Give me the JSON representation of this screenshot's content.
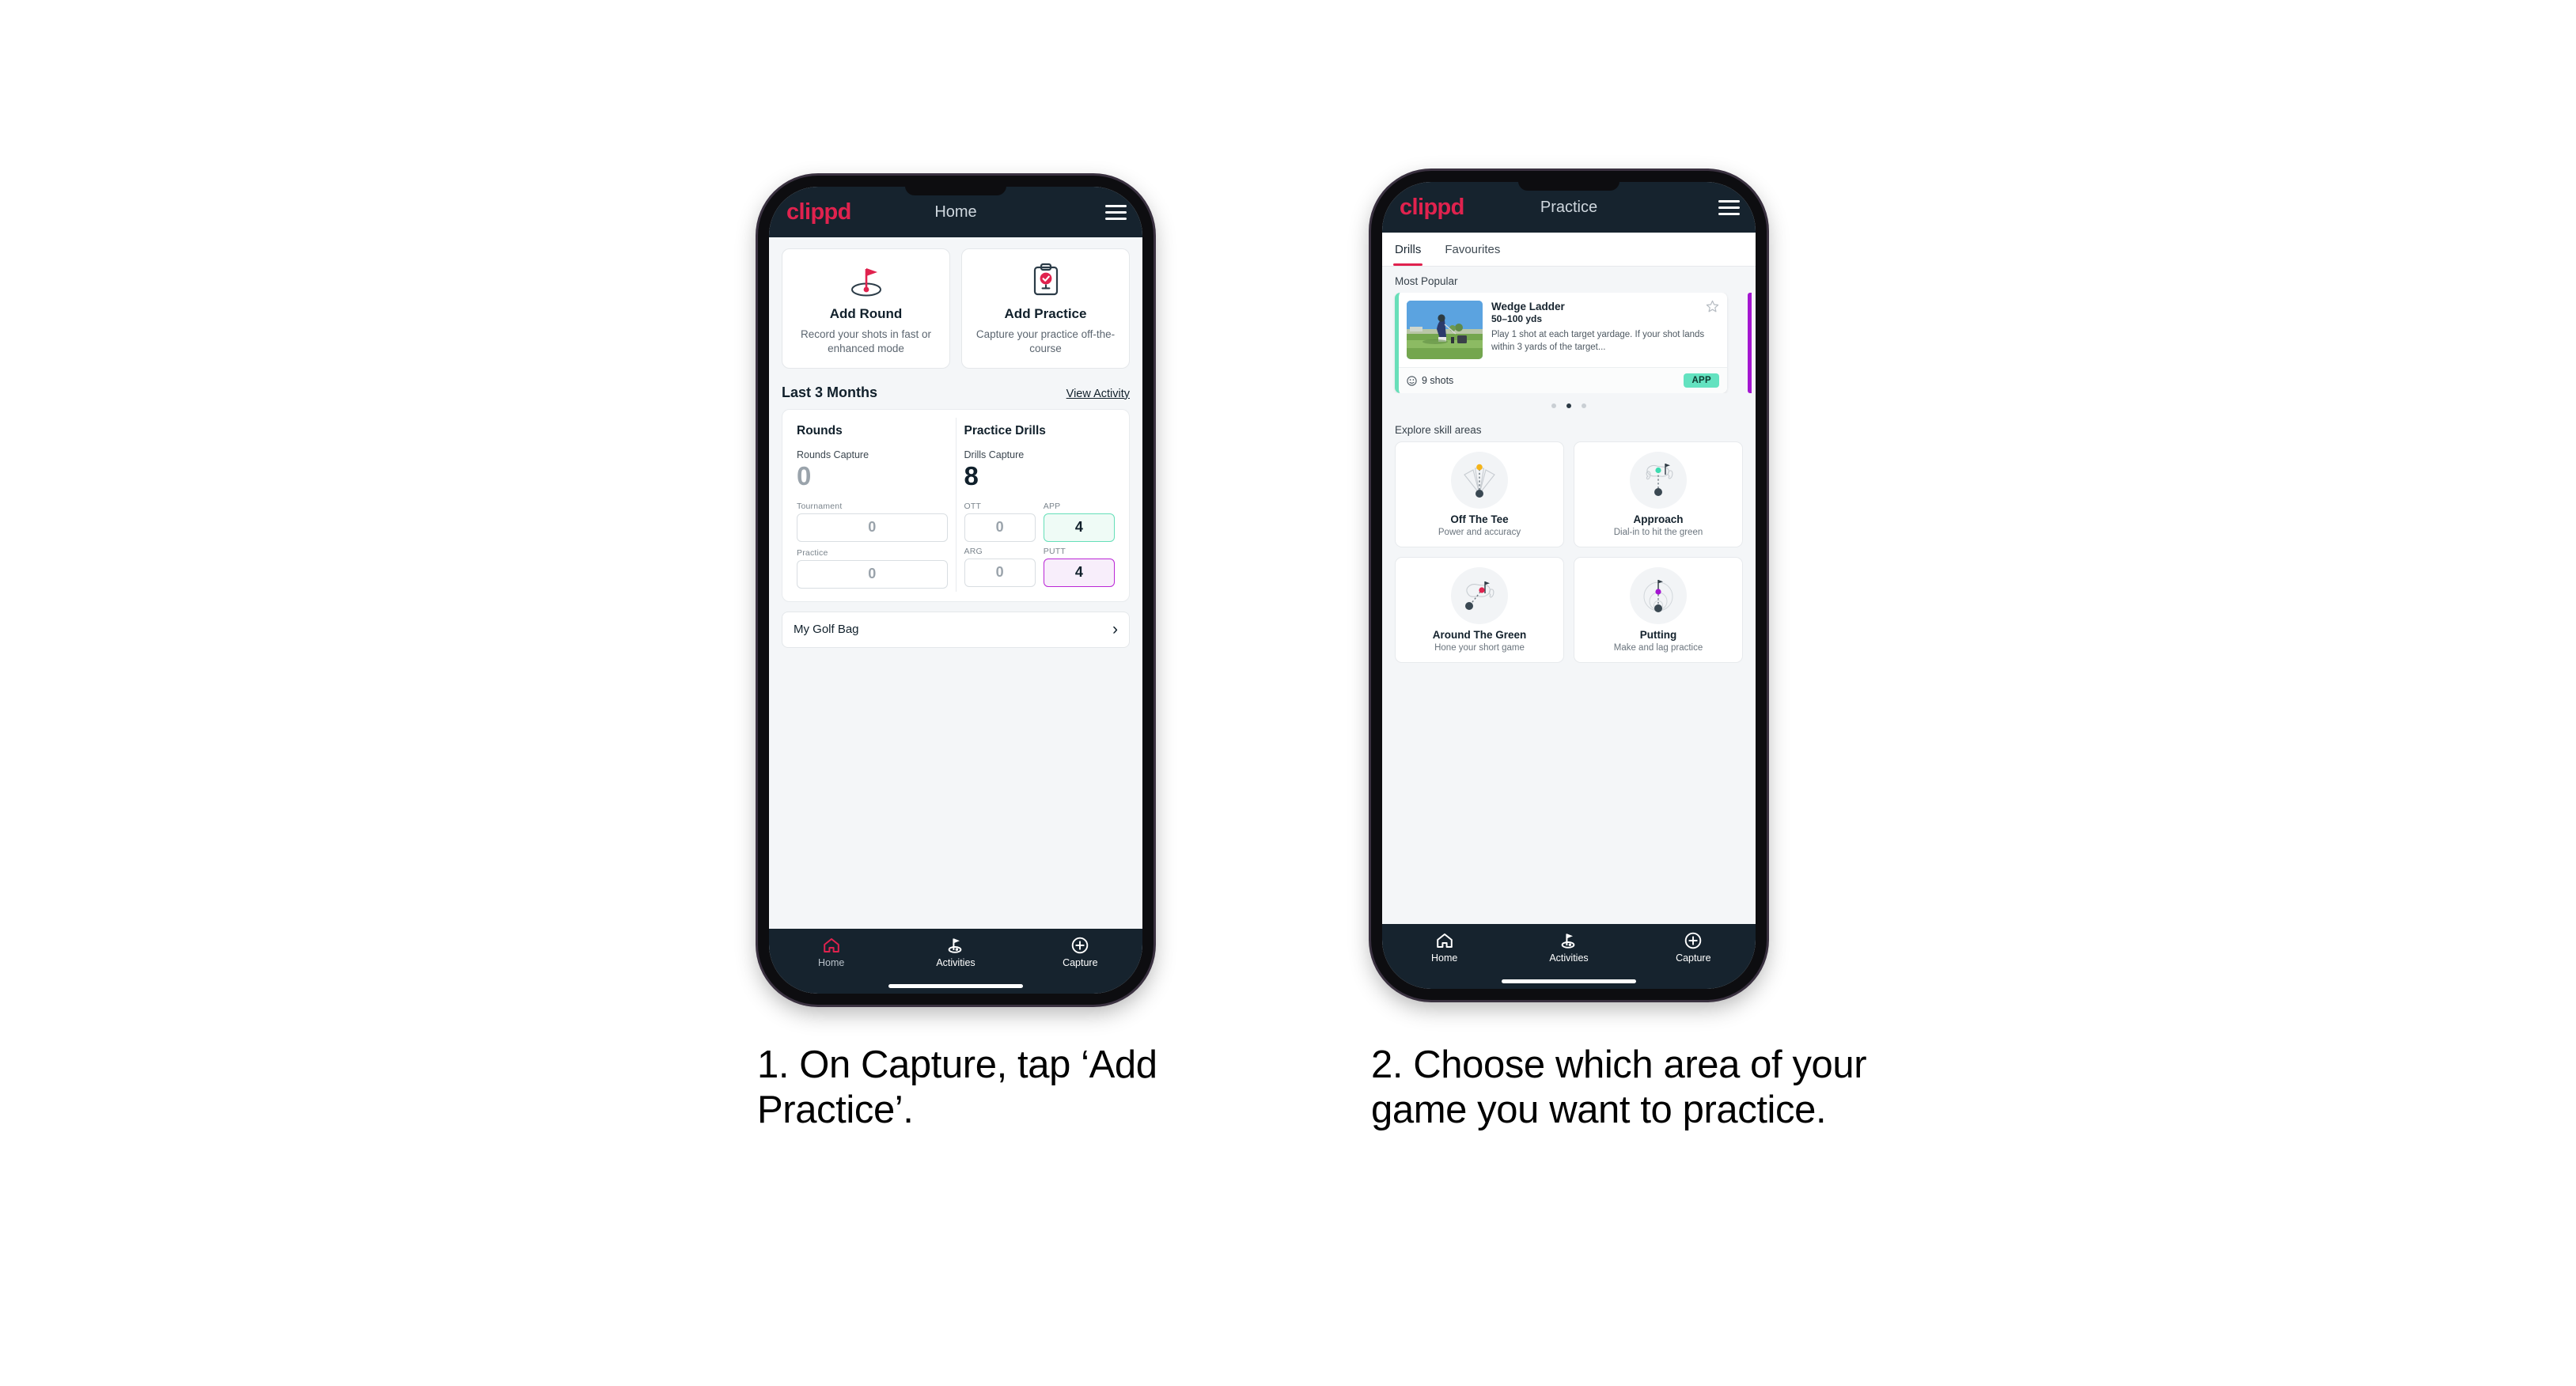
{
  "brand": "clippd",
  "phone1": {
    "header": {
      "title": "Home",
      "menu_icon": "hamburger-menu-icon"
    },
    "quick_actions": [
      {
        "icon": "golf-flag-hole-icon",
        "title": "Add Round",
        "subtitle": "Record your shots in fast or enhanced mode"
      },
      {
        "icon": "clipboard-check-icon",
        "title": "Add Practice",
        "subtitle": "Capture your practice off-the-course"
      }
    ],
    "section": {
      "title": "Last 3 Months",
      "link": "View Activity"
    },
    "rounds": {
      "heading": "Rounds",
      "capture_label": "Rounds Capture",
      "capture_value": "0",
      "fields": [
        {
          "label": "Tournament",
          "value": "0",
          "style": "empty"
        },
        {
          "label": "Practice",
          "value": "0",
          "style": "empty"
        }
      ]
    },
    "drills": {
      "heading": "Practice Drills",
      "capture_label": "Drills Capture",
      "capture_value": "8",
      "fields": [
        {
          "label": "OTT",
          "value": "0",
          "style": "empty"
        },
        {
          "label": "APP",
          "value": "4",
          "style": "mint"
        },
        {
          "label": "ARG",
          "value": "0",
          "style": "empty"
        },
        {
          "label": "PUTT",
          "value": "4",
          "style": "violet"
        }
      ]
    },
    "golf_bag": {
      "label": "My Golf Bag",
      "chevron": "chevron-right-icon"
    },
    "bottom_nav": [
      {
        "label": "Home",
        "icon": "home-icon",
        "active": true
      },
      {
        "label": "Activities",
        "icon": "golf-flag-icon",
        "active": false
      },
      {
        "label": "Capture",
        "icon": "plus-circle-icon",
        "active": false
      }
    ]
  },
  "phone2": {
    "header": {
      "title": "Practice",
      "menu_icon": "hamburger-menu-icon"
    },
    "tabs": [
      {
        "label": "Drills",
        "active": true
      },
      {
        "label": "Favourites",
        "active": false
      }
    ],
    "most_popular_label": "Most Popular",
    "drill_card": {
      "name": "Wedge Ladder",
      "range": "50–100 yds",
      "description": "Play 1 shot at each target yardage. If your shot lands within 3 yards of the target...",
      "shots": "9 shots",
      "badge": "APP",
      "star_icon": "star-outline-icon",
      "clock_icon": "clock-icon",
      "accent": "#68dfb9",
      "next_card_accent": "#a416d1"
    },
    "carousel_dots": {
      "count": 3,
      "active_index": 1
    },
    "explore_label": "Explore skill areas",
    "skill_areas": [
      {
        "title": "Off The Tee",
        "subtitle": "Power and accuracy",
        "icon": "tee-shot-dispersion-icon",
        "dot_color": "#f4b41a"
      },
      {
        "title": "Approach",
        "subtitle": "Dial-in to hit the green",
        "icon": "approach-green-icon",
        "dot_color": "#3ddbb0"
      },
      {
        "title": "Around The Green",
        "subtitle": "Hone your short game",
        "icon": "chipping-green-icon",
        "dot_color": "#e0224e"
      },
      {
        "title": "Putting",
        "subtitle": "Make and lag practice",
        "icon": "putting-rings-icon",
        "dot_color": "#a416d1"
      }
    ],
    "bottom_nav": [
      {
        "label": "Home",
        "icon": "home-icon",
        "active": false
      },
      {
        "label": "Activities",
        "icon": "golf-flag-icon",
        "active": false
      },
      {
        "label": "Capture",
        "icon": "plus-circle-icon",
        "active": false
      }
    ]
  },
  "captions": {
    "one": "1. On Capture, tap ‘Add Practice’.",
    "two": "2. Choose which area of your game you want to practice."
  }
}
